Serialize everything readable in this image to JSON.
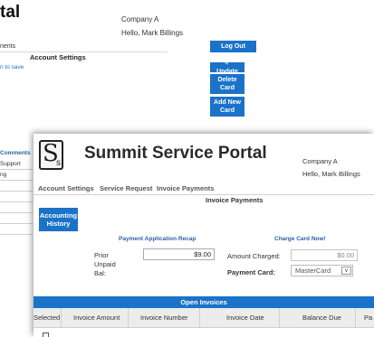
{
  "background": {
    "title_fragment": "tal",
    "company": "Company A",
    "greeting": "Hello, Mark Billings",
    "nav_fragment": "nents",
    "section": "Account Settings",
    "save_fragment": "n to save",
    "logout_label": "Log Out",
    "update_label": "Update",
    "delete_label": [
      "Delete",
      "Card"
    ],
    "add_label": [
      "Add New",
      "Card"
    ],
    "sidebar_title": "Comments",
    "sidebar_items": [
      "Support",
      "ng"
    ]
  },
  "window": {
    "logo_letters": [
      "S",
      "s"
    ],
    "portal_title": "Summit Service Portal",
    "company": "Company A",
    "greeting": "Hello, Mark Billings",
    "nav": [
      "Account Settings",
      "Service Request",
      "Invoice Payments"
    ],
    "section_title": "Invoice Payments",
    "accounting_history": [
      "Accounting",
      "History"
    ],
    "recap_title": "Payment Application Recap",
    "charge_title": "Charge Card Now!",
    "prior_unpaid_label": [
      "Prior Unpaid",
      "Bal:"
    ],
    "prior_unpaid_value": "$9.00",
    "amount_charged_label": "Amount Charged:",
    "amount_charged_value": "$0.00",
    "payment_card_label": "Payment Card:",
    "payment_card_value": "MasterCard",
    "open_invoices_title": "Open Invoices",
    "columns": [
      "Selected",
      "Invoice Amount",
      "Invoice Number",
      "Invoice Date",
      "Balance Due",
      "Pa"
    ]
  },
  "colors": {
    "accent": "#1a73c9",
    "link": "#2a62a8"
  }
}
